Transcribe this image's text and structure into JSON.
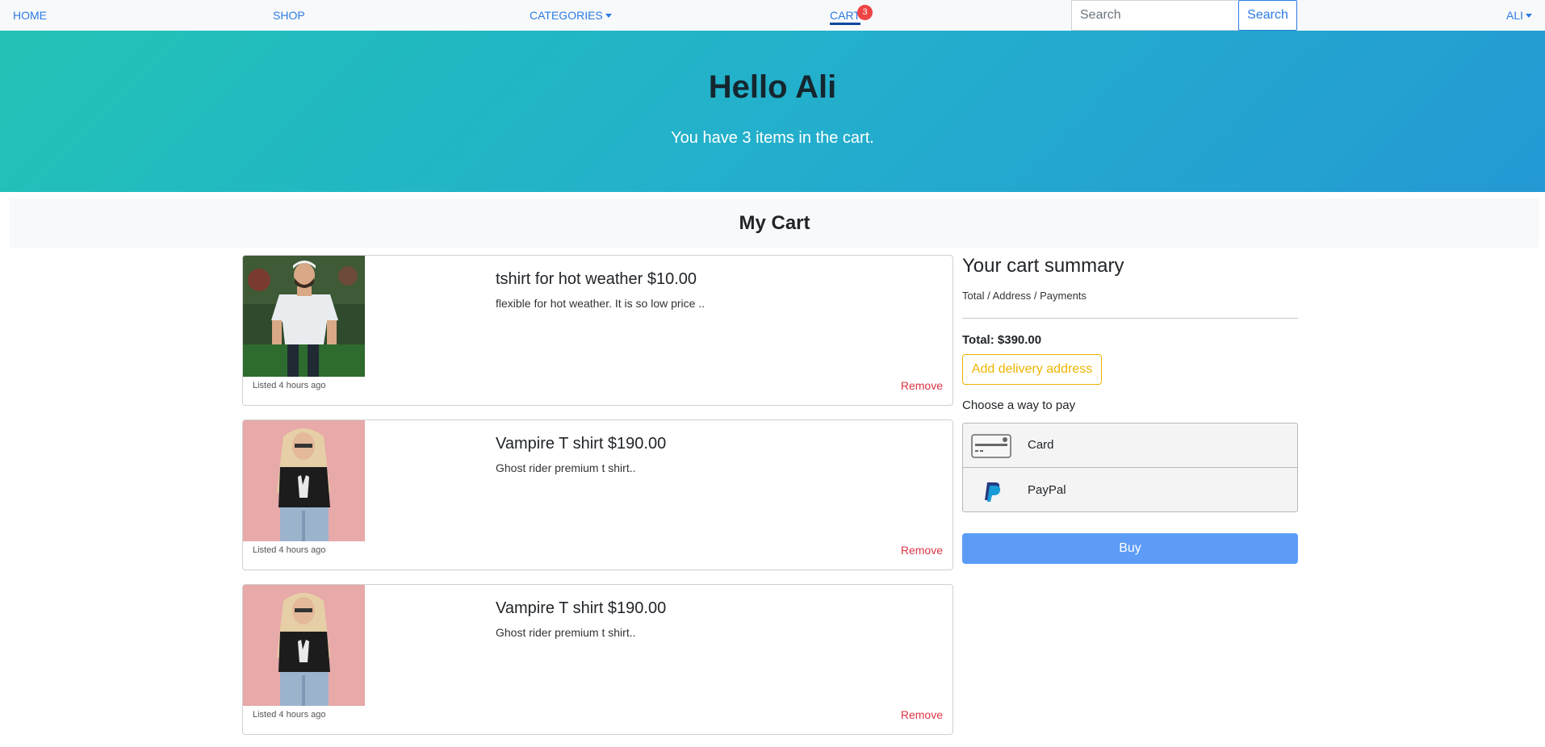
{
  "nav": {
    "home": "HOME",
    "shop": "SHOP",
    "categories": "CATEGORIES",
    "cart": "CART",
    "cart_count": "3",
    "search_placeholder": "Search",
    "search_button": "Search",
    "user": "ALI"
  },
  "hero": {
    "title": "Hello Ali",
    "subtitle": "You have 3 items in the cart."
  },
  "cart": {
    "heading": "My Cart",
    "items": [
      {
        "title": "tshirt for hot weather $10.00",
        "description": "flexible for hot weather. It is so low price ..",
        "listed": "Listed 4 hours ago",
        "remove": "Remove"
      },
      {
        "title": "Vampire T shirt $190.00",
        "description": "Ghost rider premium t shirt..",
        "listed": "Listed 4 hours ago",
        "remove": "Remove"
      },
      {
        "title": "Vampire T shirt $190.00",
        "description": "Ghost rider premium t shirt..",
        "listed": "Listed 4 hours ago",
        "remove": "Remove"
      }
    ]
  },
  "summary": {
    "title": "Your cart summary",
    "breadcrumbs": "Total / Address / Payments",
    "total": "Total: $390.00",
    "address_button": "Add delivery address",
    "pay_label": "Choose a way to pay",
    "pay_options": [
      {
        "label": "Card",
        "icon": "credit-card-icon"
      },
      {
        "label": "PayPal",
        "icon": "paypal-icon"
      }
    ],
    "buy_button": "Buy"
  },
  "colors": {
    "accent": "#2c7be5",
    "danger": "#dc3545",
    "warning": "#f0b400",
    "buy": "#5c9cf7"
  }
}
